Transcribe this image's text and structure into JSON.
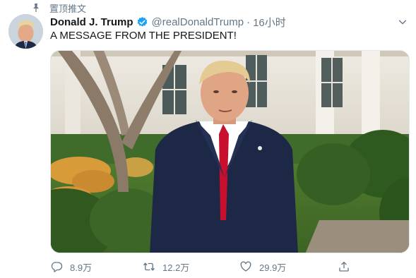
{
  "pinned_label": "置顶推文",
  "author": {
    "name": "Donald J. Trump",
    "handle": "@realDonaldTrump",
    "separator": "·",
    "time": "16小时",
    "verified": true
  },
  "tweet_text": "A MESSAGE FROM THE PRESIDENT!",
  "actions": {
    "replies": "8.9万",
    "retweets": "12.2万",
    "likes": "29.9万"
  },
  "icons": {
    "pin": "pin-icon",
    "verified": "verified-badge-icon",
    "more": "chevron-down-icon",
    "reply": "reply-icon",
    "retweet": "retweet-icon",
    "like": "heart-icon",
    "share": "share-icon"
  },
  "colors": {
    "verified_blue": "#1da1f2",
    "secondary_text": "#657786",
    "primary_text": "#14171a"
  }
}
